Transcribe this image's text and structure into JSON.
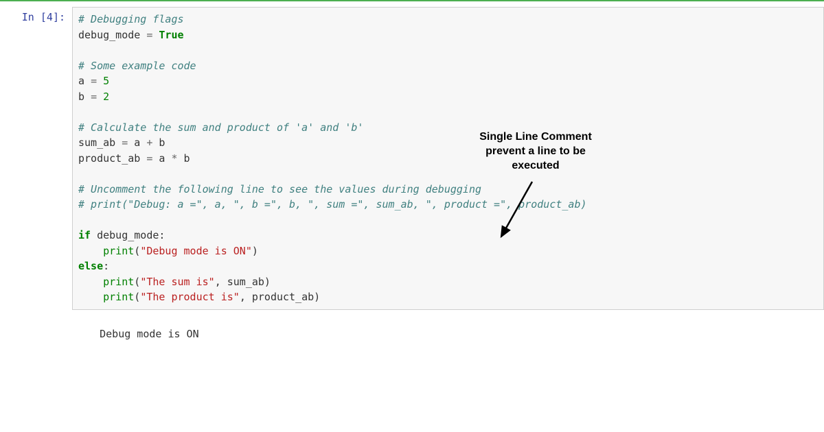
{
  "prompt": {
    "label": "In [",
    "num": "4",
    "close": "]:"
  },
  "code": {
    "c1": "# Debugging flags",
    "l2a": "debug_mode ",
    "l2b": "=",
    "l2c": " True",
    "c3": "# Some example code",
    "l4a": "a ",
    "l4b": "=",
    "l4c": " 5",
    "l5a": "b ",
    "l5b": "=",
    "l5c": " 2",
    "c6": "# Calculate the sum and product of 'a' and 'b'",
    "l7a": "sum_ab ",
    "l7b": "=",
    "l7c": " a ",
    "l7d": "+",
    "l7e": " b",
    "l8a": "product_ab ",
    "l8b": "=",
    "l8c": " a ",
    "l8d": "*",
    "l8e": " b",
    "c9": "# Uncomment the following line to see the values during debugging",
    "c10": "# print(\"Debug: a =\", a, \", b =\", b, \", sum =\", sum_ab, \", product =\", product_ab)",
    "l11a": "if",
    "l11b": " debug_mode:",
    "l12a": "    ",
    "l12b": "print",
    "l12c": "(",
    "l12d": "\"Debug mode is ON\"",
    "l12e": ")",
    "l13a": "else",
    "l13b": ":",
    "l14a": "    ",
    "l14b": "print",
    "l14c": "(",
    "l14d": "\"The sum is\"",
    "l14e": ", sum_ab)",
    "l15a": "    ",
    "l15b": "print",
    "l15c": "(",
    "l15d": "\"The product is\"",
    "l15e": ", product_ab)"
  },
  "output": "Debug mode is ON",
  "annotation": {
    "line1": "Single Line Comment",
    "line2": "prevent a line to be",
    "line3": "executed"
  }
}
